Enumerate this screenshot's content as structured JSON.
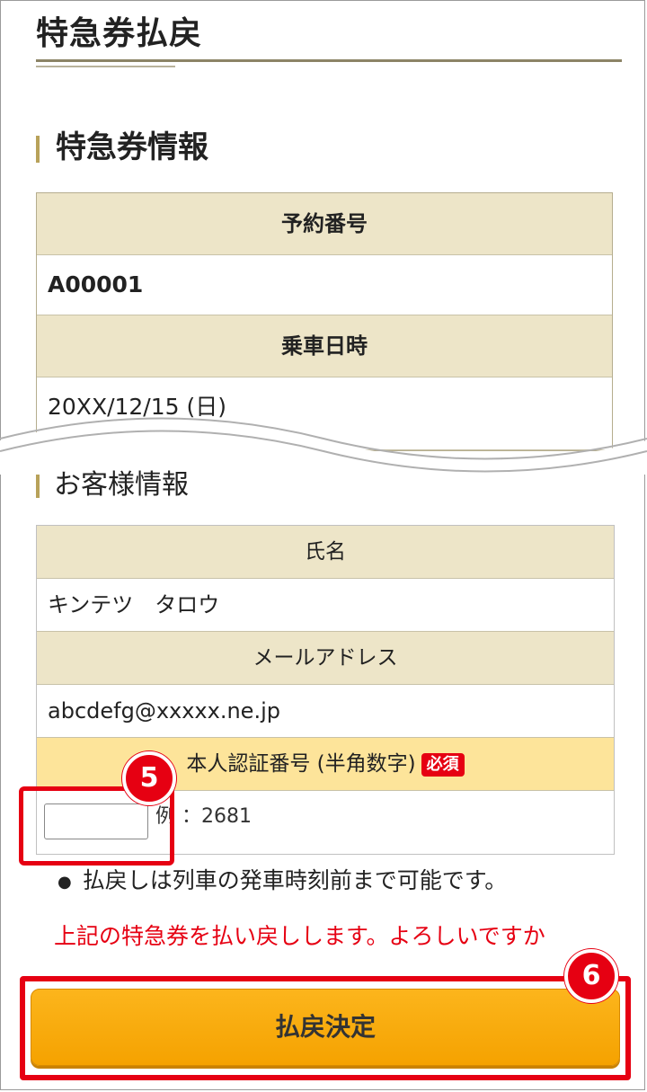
{
  "page": {
    "title": "特急券払戻"
  },
  "ticket_section": {
    "heading": "特急券情報",
    "reservation_label": "予約番号",
    "reservation_value": "A00001",
    "ride_label": "乗車日時",
    "ride_value": "20XX/12/15 (日)"
  },
  "customer_section": {
    "heading": "お客様情報",
    "name_label": "氏名",
    "name_value": "キンテツ　タロウ",
    "email_label": "メールアドレス",
    "email_value": "abcdefg@xxxxx.ne.jp",
    "auth_label": "本人認証番号 (半角数字)",
    "required_badge": "必須",
    "auth_value": "",
    "auth_example": "例 ：2681"
  },
  "note": "払戻しは列車の発車時刻前まで可能です。",
  "confirm_text": "上記の特急券を払い戻しします。よろしいですか",
  "submit_label": "払戻決定",
  "markers": {
    "step5": "5",
    "step6": "6"
  },
  "colors": {
    "header_bg": "#ede5c8",
    "auth_header_bg": "#fde49a",
    "accent_red": "#e60012",
    "button_orange": "#f5a200"
  }
}
